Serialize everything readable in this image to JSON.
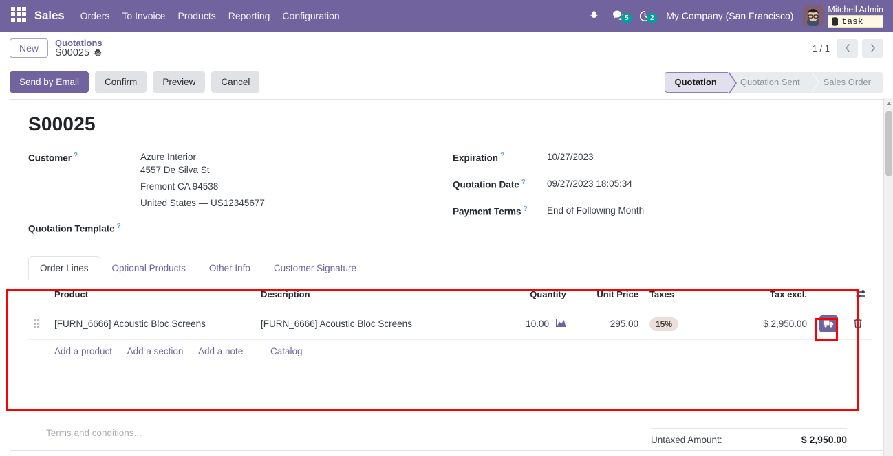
{
  "navbar": {
    "apps_icon": "apps-grid-icon",
    "brand": "Sales",
    "menu": [
      {
        "label": "Orders"
      },
      {
        "label": "To Invoice"
      },
      {
        "label": "Products"
      },
      {
        "label": "Reporting"
      },
      {
        "label": "Configuration"
      }
    ],
    "bug_icon": "bug-icon",
    "messages": {
      "icon": "chat-bubble-icon",
      "count": "5"
    },
    "activities": {
      "icon": "clock-activity-icon",
      "count": "2"
    },
    "company": "My Company (San Francisco)",
    "avatar_icon": "user-avatar",
    "user_name": "Mitchell Admin",
    "task_tooltip": {
      "icon": "database-icon",
      "label": "task"
    }
  },
  "control_panel": {
    "new_button": "New",
    "breadcrumb_parent": "Quotations",
    "breadcrumb_current": "S00025",
    "gear_icon": "gear-icon",
    "pager_text": "1 / 1",
    "prev_icon": "chevron-left-icon",
    "next_icon": "chevron-right-icon",
    "buttons": [
      {
        "label": "Send by Email",
        "style": "primary"
      },
      {
        "label": "Confirm",
        "style": "secondary"
      },
      {
        "label": "Preview",
        "style": "secondary"
      },
      {
        "label": "Cancel",
        "style": "secondary"
      }
    ],
    "status": [
      {
        "label": "Quotation",
        "active": true
      },
      {
        "label": "Quotation Sent",
        "active": false
      },
      {
        "label": "Sales Order",
        "active": false
      }
    ]
  },
  "record": {
    "title": "S00025",
    "left_fields": {
      "customer_label": "Customer",
      "customer_value": "Azure Interior",
      "address": [
        "4557 De Silva St",
        "Fremont CA 94538",
        "United States — US12345677"
      ],
      "template_label": "Quotation Template",
      "template_value": ""
    },
    "right_fields": [
      {
        "label": "Expiration",
        "value": "10/27/2023"
      },
      {
        "label": "Quotation Date",
        "value": "09/27/2023 18:05:34"
      },
      {
        "label": "Payment Terms",
        "value": "End of Following Month"
      }
    ]
  },
  "notebook": {
    "tabs": [
      {
        "label": "Order Lines",
        "active": true
      },
      {
        "label": "Optional Products",
        "active": false
      },
      {
        "label": "Other Info",
        "active": false
      },
      {
        "label": "Customer Signature",
        "active": false
      }
    ]
  },
  "order_lines": {
    "headers": {
      "product": "Product",
      "description": "Description",
      "quantity": "Quantity",
      "unit_price": "Unit Price",
      "taxes": "Taxes",
      "tax_excl": "Tax excl.",
      "optional_columns_icon": "sliders-icon"
    },
    "rows": [
      {
        "handle_icon": "drag-handle-icon",
        "product": "[FURN_6666] Acoustic Bloc Screens",
        "description": "[FURN_6666] Acoustic Bloc Screens",
        "quantity": "10.00",
        "qty_icon": "area-chart-icon",
        "unit_price": "295.00",
        "taxes": "15%",
        "tax_excl": "$ 2,950.00",
        "delivery_icon": "truck-icon",
        "delete_icon": "trash-icon"
      }
    ],
    "add_links": [
      {
        "label": "Add a product"
      },
      {
        "label": "Add a section"
      },
      {
        "label": "Add a note"
      },
      {
        "label": "Catalog"
      }
    ]
  },
  "footer": {
    "terms_placeholder": "Terms and conditions...",
    "untaxed_label": "Untaxed Amount:",
    "untaxed_value": "$ 2,950.00"
  },
  "colors": {
    "brand_purple": "#71639e",
    "highlight_red": "#ff0000",
    "badge_teal": "#00a09d",
    "tax_pill_bg": "#ebe0dd"
  }
}
